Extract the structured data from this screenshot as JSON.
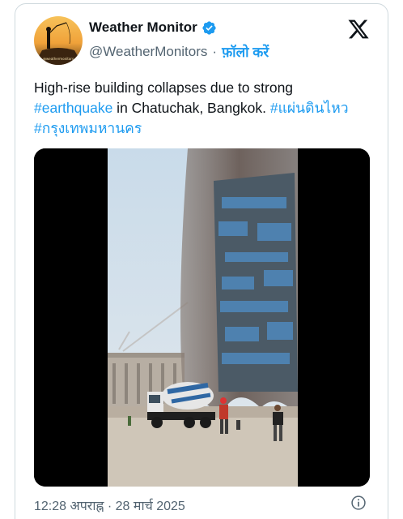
{
  "author": {
    "name": "Weather Monitor",
    "handle": "@WeatherMonitors",
    "separator": "·",
    "follow_label": "फ़ॉलो करें",
    "avatar_caption": "@weathermonitors"
  },
  "tweet": {
    "text_before_tag1": "High-rise building collapses due to strong ",
    "hashtag1": "#earthquake",
    "text_between": " in Chatuchak, Bangkok. ",
    "hashtag2": "#แผ่นดินไหว",
    "hashtag3": "#กรุงเทพมหานคร"
  },
  "footer": {
    "timestamp": "12:28 अपराह्न · 28 मार्च 2025"
  },
  "colors": {
    "accent": "#1d9bf0",
    "text_primary": "#0f1419",
    "text_secondary": "#536471",
    "border": "#cfd9de"
  },
  "icons": [
    "verified-badge-icon",
    "x-logo-icon",
    "info-icon"
  ]
}
